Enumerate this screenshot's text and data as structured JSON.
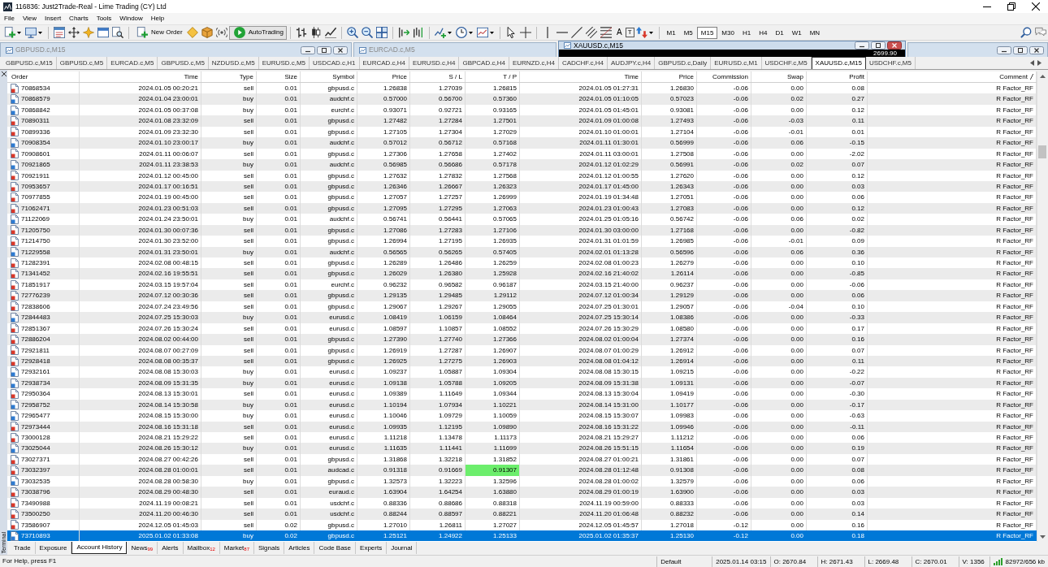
{
  "window": {
    "title": "116836: Just2Trade-Real - Lime Trading (CY) Ltd"
  },
  "menu": [
    "File",
    "View",
    "Insert",
    "Charts",
    "Tools",
    "Window",
    "Help"
  ],
  "toolbar": {
    "new_order": "New Order",
    "autotrading": "AutoTrading",
    "text_tool": "A",
    "label_tool": "T",
    "timeframes": [
      {
        "label": "M1",
        "selected": false
      },
      {
        "label": "M5",
        "selected": false
      },
      {
        "label": "M15",
        "selected": true
      },
      {
        "label": "M30",
        "selected": false
      },
      {
        "label": "H1",
        "selected": false
      },
      {
        "label": "H4",
        "selected": false
      },
      {
        "label": "D1",
        "selected": false
      },
      {
        "label": "W1",
        "selected": false
      },
      {
        "label": "MN",
        "selected": false
      }
    ]
  },
  "chart_windows": [
    {
      "title": "GBPUSD.c,M15",
      "active": false,
      "controls_shown": true
    },
    {
      "title": "EURCAD.c,M5",
      "active": false,
      "controls_shown": false
    },
    {
      "title": "XAUUSD.c,M15",
      "active": true,
      "controls_shown": true,
      "price_label": "2699.90"
    },
    {
      "active": false,
      "controls_shown": true
    }
  ],
  "chart_tabs": [
    {
      "label": "GBPUSD.c,M15",
      "selected": false
    },
    {
      "label": "GBPUSD.c,M5",
      "selected": false
    },
    {
      "label": "EURCAD.c,M5",
      "selected": false
    },
    {
      "label": "GBPUSD.c,M5",
      "selected": false
    },
    {
      "label": "NZDUSD.c,M5",
      "selected": false
    },
    {
      "label": "EURUSD.c,M5",
      "selected": false
    },
    {
      "label": "USDCAD.c,H1",
      "selected": false
    },
    {
      "label": "EURCAD.c,H4",
      "selected": false
    },
    {
      "label": "EURUSD.c,H4",
      "selected": false
    },
    {
      "label": "GBPCAD.c,H4",
      "selected": false
    },
    {
      "label": "EURNZD.c,H4",
      "selected": false
    },
    {
      "label": "CADCHF.c,H4",
      "selected": false
    },
    {
      "label": "AUDJPY.c,H4",
      "selected": false
    },
    {
      "label": "GBPUSD.c,Daily",
      "selected": false
    },
    {
      "label": "EURUSD.c,M1",
      "selected": false
    },
    {
      "label": "USDCHF.c,M5",
      "selected": false
    },
    {
      "label": "XAUUSD.c,M15",
      "selected": true
    },
    {
      "label": "USDCHF.c,M5",
      "selected": false
    }
  ],
  "terminal": {
    "label": "Terminal",
    "columns": [
      {
        "label": "Order",
        "sorted": false
      },
      {
        "label": "Time",
        "sorted": false
      },
      {
        "label": "Type",
        "sorted": false
      },
      {
        "label": "Size",
        "sorted": false
      },
      {
        "label": "Symbol",
        "sorted": false
      },
      {
        "label": "Price",
        "sorted": false
      },
      {
        "label": "S / L",
        "sorted": false
      },
      {
        "label": "T / P",
        "sorted": false
      },
      {
        "label": "Time",
        "sorted": false
      },
      {
        "label": "Price",
        "sorted": false
      },
      {
        "label": "Commission",
        "sorted": false
      },
      {
        "label": "Swap",
        "sorted": false
      },
      {
        "label": "Profit",
        "sorted": false
      },
      {
        "label": "Comment",
        "sorted": true
      }
    ],
    "rows": [
      {
        "kind": "sell",
        "selected": false,
        "tp_highlighted": false,
        "cells": [
          "70868534",
          "2024.01.05 00:20:21",
          "sell",
          "0.01",
          "gbpusd.c",
          "1.26838",
          "1.27039",
          "1.26815",
          "2024.01.05 01:27:31",
          "1.26830",
          "-0.06",
          "0.00",
          "0.08",
          "R Factor_RF"
        ]
      },
      {
        "kind": "buy",
        "selected": false,
        "tp_highlighted": false,
        "cells": [
          "70868579",
          "2024.01.04 23:00:01",
          "buy",
          "0.01",
          "audchf.c",
          "0.57000",
          "0.56700",
          "0.57360",
          "2024.01.05 01:10:05",
          "0.57023",
          "-0.06",
          "0.02",
          "0.27",
          "R Factor_RF"
        ]
      },
      {
        "kind": "buy",
        "selected": false,
        "tp_highlighted": false,
        "cells": [
          "70868842",
          "2024.01.05 00:37:08",
          "buy",
          "0.01",
          "eurchf.c",
          "0.93071",
          "0.92721",
          "0.93165",
          "2024.01.05 01:45:01",
          "0.93081",
          "-0.06",
          "0.00",
          "0.12",
          "R Factor_RF"
        ]
      },
      {
        "kind": "sell",
        "selected": false,
        "tp_highlighted": false,
        "cells": [
          "70890311",
          "2024.01.08 23:32:09",
          "sell",
          "0.01",
          "gbpusd.c",
          "1.27482",
          "1.27284",
          "1.27501",
          "2024.01.09 01:00:08",
          "1.27493",
          "-0.06",
          "-0.03",
          "0.11",
          "R Factor_RF"
        ]
      },
      {
        "kind": "sell",
        "selected": false,
        "tp_highlighted": false,
        "cells": [
          "70899336",
          "2024.01.09 23:32:30",
          "sell",
          "0.01",
          "gbpusd.c",
          "1.27105",
          "1.27304",
          "1.27029",
          "2024.01.10 01:00:01",
          "1.27104",
          "-0.06",
          "-0.01",
          "0.01",
          "R Factor_RF"
        ]
      },
      {
        "kind": "buy",
        "selected": false,
        "tp_highlighted": false,
        "cells": [
          "70908354",
          "2024.01.10 23:00:17",
          "buy",
          "0.01",
          "audchf.c",
          "0.57012",
          "0.56712",
          "0.57168",
          "2024.01.11 01:30:01",
          "0.56999",
          "-0.06",
          "0.06",
          "-0.15",
          "R Factor_RF"
        ]
      },
      {
        "kind": "sell",
        "selected": false,
        "tp_highlighted": false,
        "cells": [
          "70908601",
          "2024.01.11 00:06:07",
          "sell",
          "0.01",
          "gbpusd.c",
          "1.27306",
          "1.27658",
          "1.27402",
          "2024.01.11 03:00:01",
          "1.27508",
          "-0.06",
          "0.00",
          "-2.02",
          "R Factor_RF"
        ]
      },
      {
        "kind": "buy",
        "selected": false,
        "tp_highlighted": false,
        "cells": [
          "70921865",
          "2024.01.11 23:38:53",
          "buy",
          "0.01",
          "audchf.c",
          "0.56985",
          "0.56686",
          "0.57178",
          "2024.01.12 01:02:29",
          "0.56991",
          "-0.06",
          "0.02",
          "0.07",
          "R Factor_RF"
        ]
      },
      {
        "kind": "sell",
        "selected": false,
        "tp_highlighted": false,
        "cells": [
          "70921911",
          "2024.01.12 00:45:00",
          "sell",
          "0.01",
          "gbpusd.c",
          "1.27632",
          "1.27832",
          "1.27568",
          "2024.01.12 01:00:55",
          "1.27620",
          "-0.06",
          "0.00",
          "0.12",
          "R Factor_RF"
        ]
      },
      {
        "kind": "sell",
        "selected": false,
        "tp_highlighted": false,
        "cells": [
          "70953657",
          "2024.01.17 00:16:51",
          "sell",
          "0.01",
          "gbpusd.c",
          "1.26346",
          "1.26667",
          "1.26323",
          "2024.01.17 01:45:00",
          "1.26343",
          "-0.06",
          "0.00",
          "0.03",
          "R Factor_RF"
        ]
      },
      {
        "kind": "sell",
        "selected": false,
        "tp_highlighted": false,
        "cells": [
          "70977855",
          "2024.01.19 00:45:00",
          "sell",
          "0.01",
          "gbpusd.c",
          "1.27057",
          "1.27257",
          "1.26999",
          "2024.01.19 01:34:48",
          "1.27051",
          "-0.06",
          "0.00",
          "0.06",
          "R Factor_RF"
        ]
      },
      {
        "kind": "sell",
        "selected": false,
        "tp_highlighted": false,
        "cells": [
          "71062471",
          "2024.01.23 00:51:03",
          "sell",
          "0.01",
          "gbpusd.c",
          "1.27095",
          "1.27295",
          "1.27063",
          "2024.01.23 01:00:43",
          "1.27083",
          "-0.06",
          "0.00",
          "0.12",
          "R Factor_RF"
        ]
      },
      {
        "kind": "buy",
        "selected": false,
        "tp_highlighted": false,
        "cells": [
          "71122069",
          "2024.01.24 23:50:01",
          "buy",
          "0.01",
          "audchf.c",
          "0.56741",
          "0.56441",
          "0.57065",
          "2024.01.25 01:05:16",
          "0.56742",
          "-0.06",
          "0.06",
          "0.02",
          "R Factor_RF"
        ]
      },
      {
        "kind": "sell",
        "selected": false,
        "tp_highlighted": false,
        "cells": [
          "71205750",
          "2024.01.30 00:07:36",
          "sell",
          "0.01",
          "gbpusd.c",
          "1.27086",
          "1.27283",
          "1.27106",
          "2024.01.30 03:00:00",
          "1.27168",
          "-0.06",
          "0.00",
          "-0.82",
          "R Factor_RF"
        ]
      },
      {
        "kind": "sell",
        "selected": false,
        "tp_highlighted": false,
        "cells": [
          "71214750",
          "2024.01.30 23:52:00",
          "sell",
          "0.01",
          "gbpusd.c",
          "1.26994",
          "1.27195",
          "1.26935",
          "2024.01.31 01:01:59",
          "1.26985",
          "-0.06",
          "-0.01",
          "0.09",
          "R Factor_RF"
        ]
      },
      {
        "kind": "buy",
        "selected": false,
        "tp_highlighted": false,
        "cells": [
          "71229558",
          "2024.01.31 23:50:01",
          "buy",
          "0.01",
          "audchf.c",
          "0.56565",
          "0.56265",
          "0.57405",
          "2024.02.01 01:13:28",
          "0.56596",
          "-0.06",
          "0.06",
          "0.36",
          "R Factor_RF"
        ]
      },
      {
        "kind": "sell",
        "selected": false,
        "tp_highlighted": false,
        "cells": [
          "71282391",
          "2024.02.08 00:48:15",
          "sell",
          "0.01",
          "gbpusd.c",
          "1.26289",
          "1.26486",
          "1.26259",
          "2024.02.08 01:00:23",
          "1.26279",
          "-0.06",
          "0.00",
          "0.10",
          "R Factor_RF"
        ]
      },
      {
        "kind": "sell",
        "selected": false,
        "tp_highlighted": false,
        "cells": [
          "71341452",
          "2024.02.16 19:55:51",
          "sell",
          "0.01",
          "gbpusd.c",
          "1.26029",
          "1.26380",
          "1.25928",
          "2024.02.16 21:40:02",
          "1.26114",
          "-0.06",
          "0.00",
          "-0.85",
          "R Factor_RF"
        ]
      },
      {
        "kind": "sell",
        "selected": false,
        "tp_highlighted": false,
        "cells": [
          "71851917",
          "2024.03.15 19:57:04",
          "sell",
          "0.01",
          "eurchf.c",
          "0.96232",
          "0.96582",
          "0.96187",
          "2024.03.15 21:40:00",
          "0.96237",
          "-0.06",
          "0.00",
          "-0.06",
          "R Factor_RF"
        ]
      },
      {
        "kind": "sell",
        "selected": false,
        "tp_highlighted": false,
        "cells": [
          "72776239",
          "2024.07.12 00:30:36",
          "sell",
          "0.01",
          "gbpusd.c",
          "1.29135",
          "1.29485",
          "1.29112",
          "2024.07.12 01:00:34",
          "1.29129",
          "-0.06",
          "0.00",
          "0.06",
          "R Factor_RF"
        ]
      },
      {
        "kind": "sell",
        "selected": false,
        "tp_highlighted": false,
        "cells": [
          "72838606",
          "2024.07.24 23:49:56",
          "sell",
          "0.01",
          "gbpusd.c",
          "1.29067",
          "1.29267",
          "1.29055",
          "2024.07.25 01:30:01",
          "1.29057",
          "-0.06",
          "-0.04",
          "0.10",
          "R Factor_RF"
        ]
      },
      {
        "kind": "buy",
        "selected": false,
        "tp_highlighted": false,
        "cells": [
          "72844483",
          "2024.07.25 15:30:03",
          "buy",
          "0.01",
          "eurusd.c",
          "1.08419",
          "1.06159",
          "1.08464",
          "2024.07.25 15:30:14",
          "1.08386",
          "-0.06",
          "0.00",
          "-0.33",
          "R Factor_RF"
        ]
      },
      {
        "kind": "sell",
        "selected": false,
        "tp_highlighted": false,
        "cells": [
          "72851367",
          "2024.07.26 15:30:24",
          "sell",
          "0.01",
          "eurusd.c",
          "1.08597",
          "1.10857",
          "1.08552",
          "2024.07.26 15:30:29",
          "1.08580",
          "-0.06",
          "0.00",
          "0.17",
          "R Factor_RF"
        ]
      },
      {
        "kind": "sell",
        "selected": false,
        "tp_highlighted": false,
        "cells": [
          "72886204",
          "2024.08.02 00:44:00",
          "sell",
          "0.01",
          "gbpusd.c",
          "1.27390",
          "1.27740",
          "1.27366",
          "2024.08.02 01:00:04",
          "1.27374",
          "-0.06",
          "0.00",
          "0.16",
          "R Factor_RF"
        ]
      },
      {
        "kind": "sell",
        "selected": false,
        "tp_highlighted": false,
        "cells": [
          "72921811",
          "2024.08.07 00:27:09",
          "sell",
          "0.01",
          "gbpusd.c",
          "1.26919",
          "1.27287",
          "1.26907",
          "2024.08.07 01:00:29",
          "1.26912",
          "-0.06",
          "0.00",
          "0.07",
          "R Factor_RF"
        ]
      },
      {
        "kind": "sell",
        "selected": false,
        "tp_highlighted": false,
        "cells": [
          "72928418",
          "2024.08.08 00:35:37",
          "sell",
          "0.01",
          "gbpusd.c",
          "1.26925",
          "1.27275",
          "1.26903",
          "2024.08.08 01:04:12",
          "1.26914",
          "-0.06",
          "0.00",
          "0.11",
          "R Factor_RF"
        ]
      },
      {
        "kind": "buy",
        "selected": false,
        "tp_highlighted": false,
        "cells": [
          "72932161",
          "2024.08.08 15:30:03",
          "buy",
          "0.01",
          "eurusd.c",
          "1.09237",
          "1.05887",
          "1.09304",
          "2024.08.08 15:30:15",
          "1.09215",
          "-0.06",
          "0.00",
          "-0.22",
          "R Factor_RF"
        ]
      },
      {
        "kind": "buy",
        "selected": false,
        "tp_highlighted": false,
        "cells": [
          "72938734",
          "2024.08.09 15:31:35",
          "buy",
          "0.01",
          "eurusd.c",
          "1.09138",
          "1.05788",
          "1.09205",
          "2024.08.09 15:31:38",
          "1.09131",
          "-0.06",
          "0.00",
          "-0.07",
          "R Factor_RF"
        ]
      },
      {
        "kind": "sell",
        "selected": false,
        "tp_highlighted": false,
        "cells": [
          "72950364",
          "2024.08.13 15:30:01",
          "sell",
          "0.01",
          "eurusd.c",
          "1.09389",
          "1.11649",
          "1.09344",
          "2024.08.13 15:30:04",
          "1.09419",
          "-0.06",
          "0.00",
          "-0.30",
          "R Factor_RF"
        ]
      },
      {
        "kind": "buy",
        "selected": false,
        "tp_highlighted": false,
        "cells": [
          "72958752",
          "2024.08.14 15:30:58",
          "buy",
          "0.01",
          "eurusd.c",
          "1.10194",
          "1.07934",
          "1.10221",
          "2024.08.14 15:31:00",
          "1.10177",
          "-0.06",
          "0.00",
          "-0.17",
          "R Factor_RF"
        ]
      },
      {
        "kind": "buy",
        "selected": false,
        "tp_highlighted": false,
        "cells": [
          "72965477",
          "2024.08.15 15:30:00",
          "buy",
          "0.01",
          "eurusd.c",
          "1.10046",
          "1.09729",
          "1.10059",
          "2024.08.15 15:30:07",
          "1.09983",
          "-0.06",
          "0.00",
          "-0.63",
          "R Factor_RF"
        ]
      },
      {
        "kind": "sell",
        "selected": false,
        "tp_highlighted": false,
        "cells": [
          "72973444",
          "2024.08.16 15:31:18",
          "sell",
          "0.01",
          "eurusd.c",
          "1.09935",
          "1.12195",
          "1.09890",
          "2024.08.16 15:31:22",
          "1.09946",
          "-0.06",
          "0.00",
          "-0.11",
          "R Factor_RF"
        ]
      },
      {
        "kind": "sell",
        "selected": false,
        "tp_highlighted": false,
        "cells": [
          "73000128",
          "2024.08.21 15:29:22",
          "sell",
          "0.01",
          "eurusd.c",
          "1.11218",
          "1.13478",
          "1.11173",
          "2024.08.21 15:29:27",
          "1.11212",
          "-0.06",
          "0.00",
          "0.06",
          "R Factor_RF"
        ]
      },
      {
        "kind": "buy",
        "selected": false,
        "tp_highlighted": false,
        "cells": [
          "73025044",
          "2024.08.26 15:30:12",
          "buy",
          "0.01",
          "eurusd.c",
          "1.11635",
          "1.11441",
          "1.11699",
          "2024.08.26 15:51:15",
          "1.11654",
          "-0.06",
          "0.00",
          "0.19",
          "R Factor_RF"
        ]
      },
      {
        "kind": "sell",
        "selected": false,
        "tp_highlighted": false,
        "cells": [
          "73027371",
          "2024.08.27 00:42:26",
          "sell",
          "0.01",
          "gbpusd.c",
          "1.31868",
          "1.32218",
          "1.31852",
          "2024.08.27 01:00:21",
          "1.31861",
          "-0.06",
          "0.00",
          "0.07",
          "R Factor_RF"
        ]
      },
      {
        "kind": "sell",
        "selected": false,
        "tp_highlighted": true,
        "cells": [
          "73032397",
          "2024.08.28 01:00:01",
          "sell",
          "0.01",
          "audcad.c",
          "0.91318",
          "0.91669",
          "0.91307",
          "2024.08.28 01:12:48",
          "0.91308",
          "-0.06",
          "0.00",
          "0.08",
          "R Factor_RF"
        ]
      },
      {
        "kind": "buy",
        "selected": false,
        "tp_highlighted": false,
        "cells": [
          "73032535",
          "2024.08.28 00:58:30",
          "buy",
          "0.01",
          "gbpusd.c",
          "1.32573",
          "1.32223",
          "1.32596",
          "2024.08.28 01:00:02",
          "1.32579",
          "-0.06",
          "0.00",
          "0.06",
          "R Factor_RF"
        ]
      },
      {
        "kind": "sell",
        "selected": false,
        "tp_highlighted": false,
        "cells": [
          "73038796",
          "2024.08.29 00:48:30",
          "sell",
          "0.01",
          "euraud.c",
          "1.63904",
          "1.64254",
          "1.63880",
          "2024.08.29 01:00:19",
          "1.63900",
          "-0.06",
          "0.00",
          "0.03",
          "R Factor_RF"
        ]
      },
      {
        "kind": "sell",
        "selected": false,
        "tp_highlighted": false,
        "cells": [
          "73490988",
          "2024.11.19 00:08:21",
          "sell",
          "0.01",
          "usdchf.c",
          "0.88336",
          "0.88686",
          "0.88318",
          "2024.11.19 00:59:00",
          "0.88333",
          "-0.06",
          "0.00",
          "0.03",
          "R Factor_RF"
        ]
      },
      {
        "kind": "sell",
        "selected": false,
        "tp_highlighted": false,
        "cells": [
          "73500250",
          "2024.11.20 00:46:30",
          "sell",
          "0.01",
          "usdchf.c",
          "0.88244",
          "0.88597",
          "0.88221",
          "2024.11.20 01:06:48",
          "0.88232",
          "-0.06",
          "0.00",
          "0.14",
          "R Factor_RF"
        ]
      },
      {
        "kind": "sell",
        "selected": false,
        "tp_highlighted": false,
        "cells": [
          "73586907",
          "2024.12.05 01:45:03",
          "sell",
          "0.02",
          "gbpusd.c",
          "1.27010",
          "1.26811",
          "1.27027",
          "2024.12.05 01:45:57",
          "1.27018",
          "-0.12",
          "0.00",
          "0.16",
          "R Factor_RF"
        ]
      },
      {
        "kind": "buy",
        "selected": true,
        "tp_highlighted": false,
        "cells": [
          "73710893",
          "2025.01.02 01:33:08",
          "buy",
          "0.02",
          "gbpusd.c",
          "1.25121",
          "1.24922",
          "1.25133",
          "2025.01.02 01:35:37",
          "1.25130",
          "-0.12",
          "0.00",
          "0.18",
          "R Factor_RF"
        ]
      }
    ],
    "tabs": [
      {
        "label": "Trade",
        "selected": false
      },
      {
        "label": "Exposure",
        "selected": false
      },
      {
        "label": "Account History",
        "selected": true
      },
      {
        "label": "News$_{99}$",
        "selected": false
      },
      {
        "label": "Alerts",
        "selected": false
      },
      {
        "label": "Mailbox$_{12}$",
        "selected": false
      },
      {
        "label": "Market$_{87}$",
        "selected": false
      },
      {
        "label": "Signals",
        "selected": false
      },
      {
        "label": "Articles",
        "selected": false
      },
      {
        "label": "Code Base",
        "selected": false
      },
      {
        "label": "Experts",
        "selected": false
      },
      {
        "label": "Journal",
        "selected": false
      }
    ]
  },
  "status_bar": {
    "help": "For Help, press F1",
    "fields": [
      "Default",
      "2025.01.14 03:15",
      "O: 2670.84",
      "H: 2671.43",
      "L: 2669.48",
      "C: 2670.01",
      "V: 1356"
    ],
    "connection": "82972/656 kb"
  }
}
